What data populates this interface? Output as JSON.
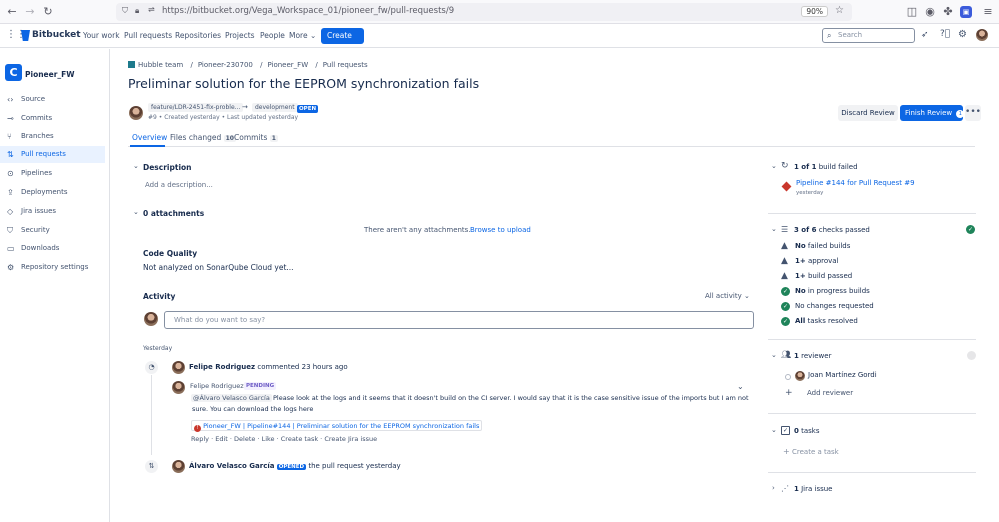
{
  "browser": {
    "url": "https://bitbucket.org/Vega_Workspace_01/pioneer_fw/pull-requests/9",
    "zoom": "90%"
  },
  "topnav": {
    "brand": "Bitbucket",
    "links": [
      "Your work",
      "Pull requests",
      "Repositories",
      "Projects",
      "People",
      "More"
    ],
    "create": "Create",
    "search_placeholder": "Search"
  },
  "sidebar": {
    "repo_name": "Pioneer_FW",
    "items": [
      "Source",
      "Commits",
      "Branches",
      "Pull requests",
      "Pipelines",
      "Deployments",
      "Jira issues",
      "Security",
      "Downloads",
      "Repository settings"
    ]
  },
  "breadcrumb": [
    "Hubble team",
    "Pioneer-230700",
    "Pioneer_FW",
    "Pull requests"
  ],
  "pr": {
    "title": "Preliminar solution for the EEPROM synchronization fails",
    "source_branch": "feature/LDR-2451-fix-proble...",
    "target_branch": "development",
    "state": "OPEN",
    "meta": "#9 • Created yesterday • Last updated yesterday",
    "discard": "Discard Review",
    "finish": "Finish Review",
    "finish_count": "1"
  },
  "tabs": [
    {
      "label": "Overview",
      "count": ""
    },
    {
      "label": "Files changed",
      "count": "10"
    },
    {
      "label": "Commits",
      "count": "1"
    }
  ],
  "description": {
    "heading": "Description",
    "placeholder": "Add a description..."
  },
  "attachments": {
    "heading": "0 attachments",
    "empty": "There aren't any attachments.",
    "browse": "Browse to upload"
  },
  "code_quality": {
    "heading": "Code Quality",
    "text": "Not analyzed on SonarQube Cloud yet..."
  },
  "activity": {
    "heading": "Activity",
    "filter": "All activity",
    "comment_placeholder": "What do you want to say?",
    "day": "Yesterday",
    "event1": {
      "author": "Felipe Rodriguez",
      "action": "commented",
      "time": "23 hours ago"
    },
    "comment": {
      "author": "Felipe Rodriguez",
      "status": "PENDING",
      "mention": "@Álvaro Velasco García",
      "line1": "Please look at the logs and it seems that it doesn't build on the CI server. I would say that it is the case sensitive issue of the imports but I am not",
      "line2": "sure. You can download the logs here",
      "link": "Pioneer_FW | Pipeline#144 | Preliminar solution for the EEPROM synchronization fails",
      "actions": [
        "Reply",
        "Edit",
        "Delete",
        "Like",
        "Create task",
        "Create Jira issue"
      ]
    },
    "event2": {
      "author": "Álvaro Velasco García",
      "badge": "OPENED",
      "action": "the pull request",
      "time": "yesterday"
    }
  },
  "right": {
    "builds": {
      "count": "1 of 1",
      "label": "build failed",
      "pipeline": "Pipeline #144 for Pull Request #9",
      "time": "yesterday"
    },
    "checks": {
      "count": "3 of 6",
      "label": "checks passed",
      "items": [
        {
          "bold": "No",
          "text": "failed builds",
          "ok": false
        },
        {
          "bold": "1+",
          "text": "approval",
          "ok": false
        },
        {
          "bold": "1+",
          "text": "build passed",
          "ok": false
        },
        {
          "bold": "No",
          "text": "in progress builds",
          "ok": true
        },
        {
          "bold": "",
          "text": "No changes requested",
          "ok": true
        },
        {
          "bold": "All",
          "text": "tasks resolved",
          "ok": true
        }
      ]
    },
    "reviewers": {
      "count": "1",
      "label": "reviewer",
      "name": "Joan Martínez Gordi",
      "add": "Add reviewer"
    },
    "tasks": {
      "count": "0",
      "label": "tasks",
      "create": "Create a task"
    },
    "jira": {
      "count": "1",
      "label": "Jira issue"
    }
  }
}
